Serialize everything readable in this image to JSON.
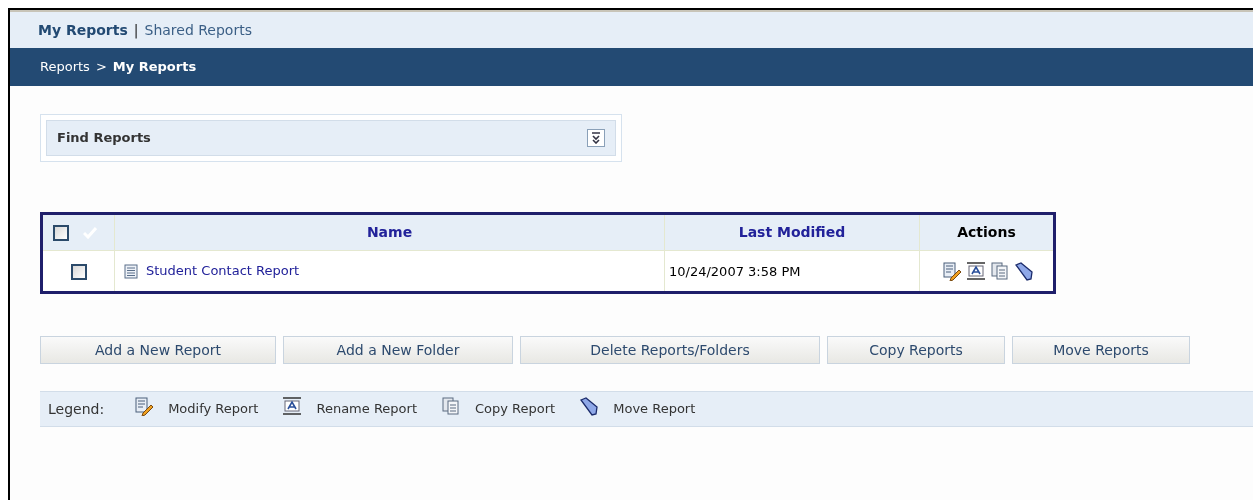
{
  "tabs": [
    {
      "label": "My Reports",
      "selected": true
    },
    {
      "label": "Shared Reports",
      "selected": false
    }
  ],
  "tab_separator": "|",
  "breadcrumb": [
    {
      "label": "Reports",
      "current": false
    },
    {
      "label": "My Reports",
      "current": true
    }
  ],
  "breadcrumb_separator": ">",
  "find_panel": {
    "title": "Find Reports"
  },
  "table": {
    "select_all_checked": false,
    "columns": [
      {
        "label": "Name",
        "sortable": true
      },
      {
        "label": "Last Modified",
        "sortable": true
      },
      {
        "label": "Actions",
        "sortable": false
      }
    ],
    "rows": [
      {
        "checked": false,
        "name": "Student Contact Report",
        "last_modified": "10/24/2007 3:58 PM",
        "actions": [
          {
            "kind": "modify"
          },
          {
            "kind": "rename"
          },
          {
            "kind": "copy"
          },
          {
            "kind": "move"
          }
        ]
      }
    ]
  },
  "buttons": [
    "Add a New Report",
    "Add a New Folder",
    "Delete Reports/Folders",
    "Copy Reports",
    "Move Reports"
  ],
  "legend": {
    "label": "Legend:",
    "items": [
      {
        "kind": "modify",
        "label": "Modify Report"
      },
      {
        "kind": "rename",
        "label": "Rename Report"
      },
      {
        "kind": "copy",
        "label": "Copy Report"
      },
      {
        "kind": "move",
        "label": "Move Report"
      }
    ]
  }
}
